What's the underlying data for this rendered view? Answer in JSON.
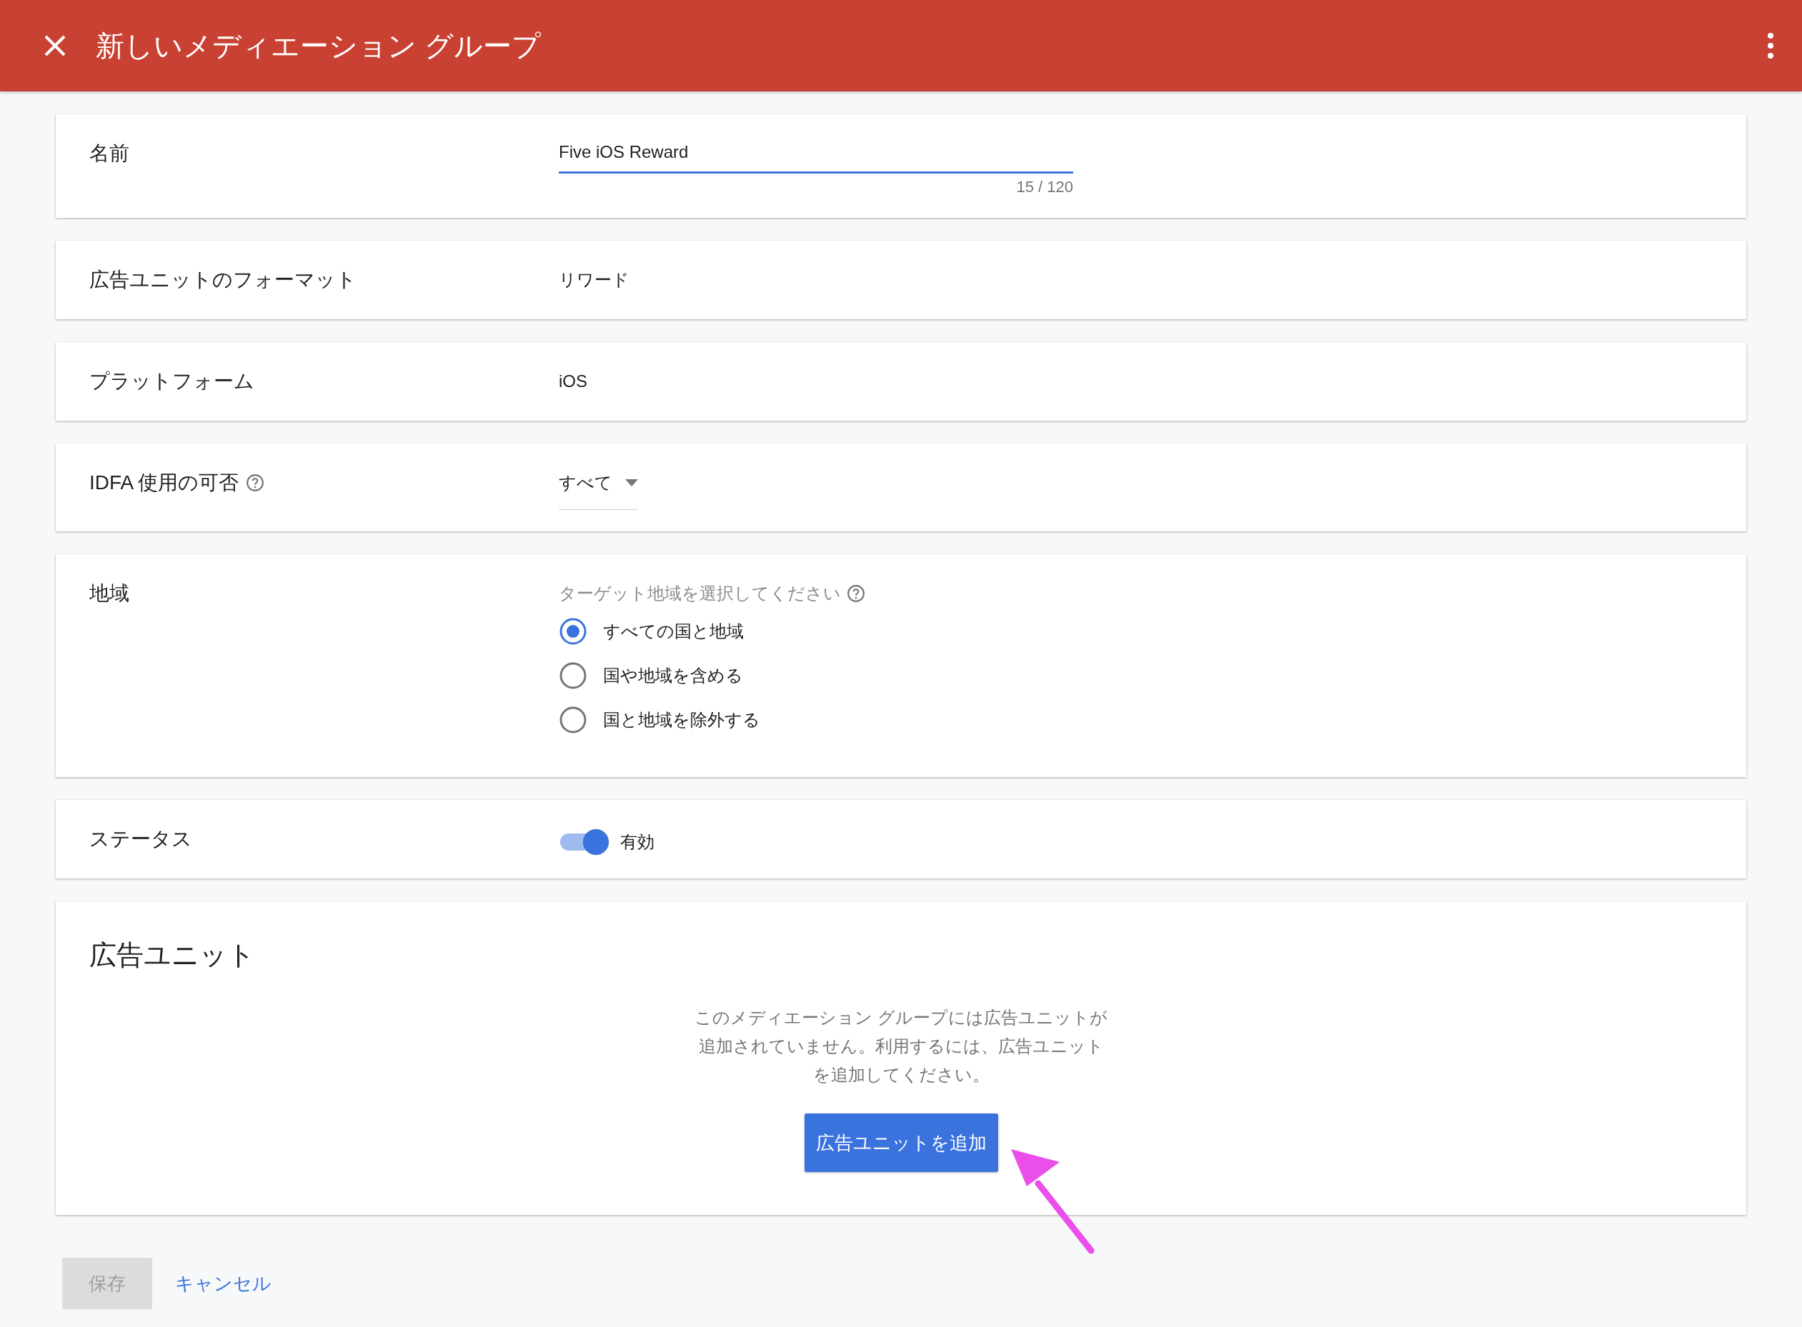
{
  "header": {
    "title": "新しいメディエーション グループ"
  },
  "fields": [
    {
      "kind": "text_input",
      "label": "名前",
      "value": "Five iOS Reward",
      "counter": "15 / 120"
    },
    {
      "kind": "static",
      "label": "広告ユニットのフォーマット",
      "value": "リワード"
    },
    {
      "kind": "static",
      "label": "プラットフォーム",
      "value": "iOS"
    },
    {
      "kind": "dropdown",
      "label": "IDFA 使用の可否",
      "help_icon": true,
      "value": "すべて"
    },
    {
      "kind": "radio",
      "label": "地域",
      "hint": "ターゲット地域を選択してください",
      "help_icon": true,
      "options": [
        {
          "label": "すべての国と地域",
          "selected": true
        },
        {
          "label": "国や地域を含める",
          "selected": false
        },
        {
          "label": "国と地域を除外する",
          "selected": false
        }
      ]
    },
    {
      "kind": "toggle",
      "label": "ステータス",
      "on": true,
      "value": "有効"
    }
  ],
  "ad_units": {
    "title": "広告ユニット",
    "message": "このメディエーション グループには広告ユニットが追加されていません。利用するには、広告ユニットを追加してください。",
    "button": "広告ユニットを追加"
  },
  "footer": {
    "save": {
      "label": "保存",
      "disabled": true
    },
    "cancel": "キャンセル"
  }
}
